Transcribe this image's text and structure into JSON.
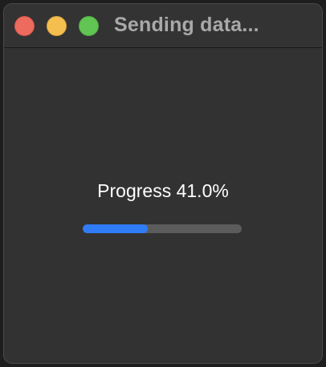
{
  "window": {
    "title": "Sending data..."
  },
  "progress": {
    "label": "Progress 41.0%",
    "value": 0.41
  },
  "colors": {
    "accent": "#2f7cf6",
    "close": "#ed6a5e",
    "minimize": "#f5bf4f",
    "zoom": "#61c554"
  }
}
